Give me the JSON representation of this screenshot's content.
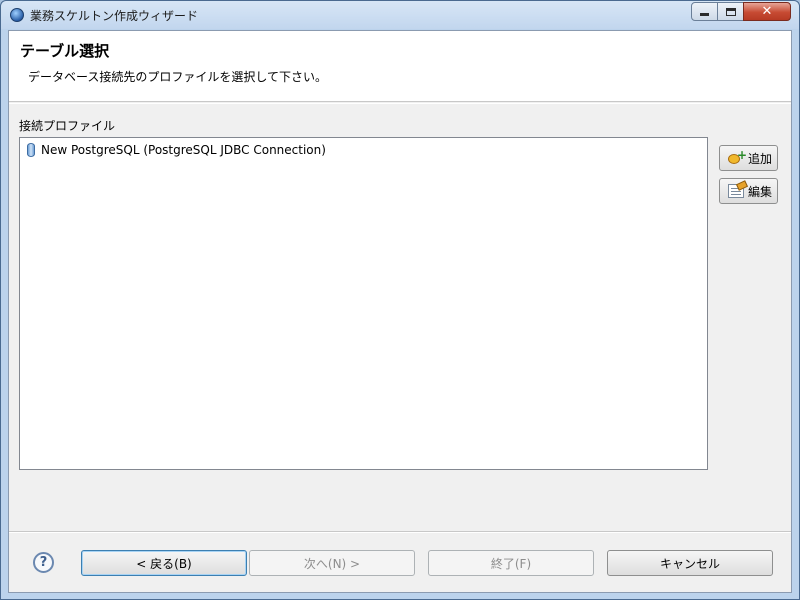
{
  "window": {
    "title": "業務スケルトン作成ウィザード",
    "close_glyph": "✕"
  },
  "header": {
    "title": "テーブル選択",
    "description": "データベース接続先のプロファイルを選択して下さい。"
  },
  "profiles": {
    "label": "接続プロファイル",
    "items": [
      {
        "label": "New PostgreSQL (PostgreSQL JDBC Connection)",
        "icon": "database-icon"
      }
    ]
  },
  "side_buttons": {
    "add_label": "追加",
    "edit_label": "編集"
  },
  "footer": {
    "help_glyph": "?",
    "back_label": "< 戻る(B)",
    "next_label": "次へ(N) >",
    "finish_label": "終了(F)",
    "cancel_label": "キャンセル"
  }
}
